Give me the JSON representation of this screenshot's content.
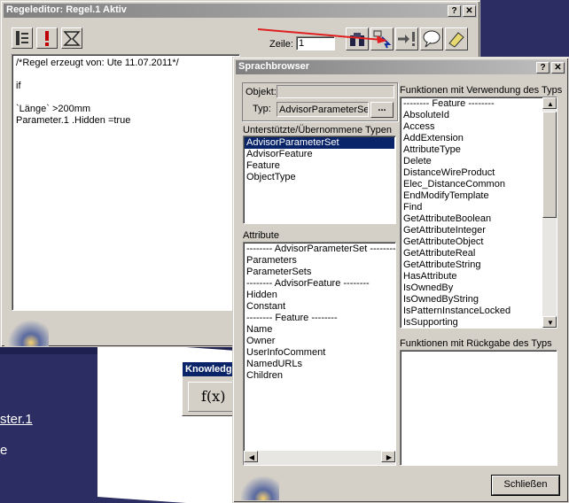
{
  "background": {
    "toolbar_title": "Knowledge",
    "formula_icon": "f(x)",
    "partial_text_1": "ster.1",
    "partial_text_2": "e"
  },
  "rule_editor": {
    "title": "Regeleditor: Regel.1 Aktiv",
    "help_btn": "?",
    "close_btn": "✕",
    "line_label": "Zeile:",
    "line_value": "1",
    "code_lines": [
      "/*Regel erzeugt von: Ute 11.07.2011*/",
      "",
      "if",
      "",
      "`Länge` >200mm",
      "Parameter.1 .Hidden   =true"
    ]
  },
  "language_browser": {
    "title": "Sprachbrowser",
    "help_btn": "?",
    "close_btn": "✕",
    "object_label": "Objekt:",
    "object_value": "",
    "type_label": "Typ:",
    "type_value": "AdvisorParameterSet",
    "browse_btn": "...",
    "types_header": "Unterstützte/Übernommene Typen",
    "types": [
      "AdvisorParameterSet",
      "AdvisorFeature",
      "Feature",
      "ObjectType"
    ],
    "attributes_header": "Attribute",
    "attributes": [
      "-------- AdvisorParameterSet --------",
      "Parameters",
      "ParameterSets",
      "-------- AdvisorFeature --------",
      "Hidden",
      "Constant",
      "-------- Feature --------",
      "Name",
      "Owner",
      "UserInfoComment",
      "NamedURLs",
      "Children"
    ],
    "functions_header": "Funktionen mit Verwendung des Typs",
    "functions": [
      "-------- Feature --------",
      "AbsoluteId",
      "Access",
      "AddExtension",
      "AttributeType",
      "Delete",
      "DistanceWireProduct",
      "Elec_DistanceCommon",
      "EndModifyTemplate",
      "Find",
      "GetAttributeBoolean",
      "GetAttributeInteger",
      "GetAttributeObject",
      "GetAttributeReal",
      "GetAttributeString",
      "HasAttribute",
      "IsOwnedBy",
      "IsOwnedByString",
      "IsPatternInstanceLocked",
      "IsSupporting"
    ],
    "return_functions_header": "Funktionen mit Rückgabe des Typs",
    "close_button": "Schließen"
  },
  "colors": {
    "selection": "#0a246a",
    "dialog_bg": "#d4d0c8",
    "background": "#2b2d63",
    "arrow": "#e02020"
  }
}
